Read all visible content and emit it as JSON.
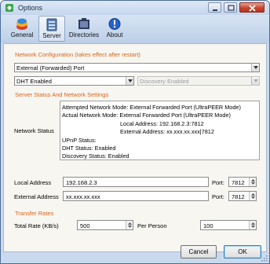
{
  "window": {
    "title": "Options"
  },
  "toolbar": {
    "items": [
      {
        "label": "General",
        "icon": "general-icon"
      },
      {
        "label": "Server",
        "icon": "server-icon",
        "active": true
      },
      {
        "label": "Directories",
        "icon": "directories-icon"
      },
      {
        "label": "About",
        "icon": "about-icon"
      }
    ]
  },
  "network_config": {
    "title": "Network Configuration (takes effect after restart)",
    "mode_select": "External (Forwarded) Port",
    "dht_select": "DHT Enabled",
    "discovery_select": "Discovery Enabled"
  },
  "server_status": {
    "title": "Server Status And Network Settings",
    "label": "Network Status",
    "lines": {
      "attempted": "Attempted Network Mode: External Forwarded Port (UltraPEER Mode)",
      "actual": "Actual Network Mode: External Forwarded Port (UltraPEER Mode)",
      "local": "Local Address: 192.168.2.3:7812",
      "external": "External Address: xx.xxx.xx.xxx|7812",
      "upnp": "UPnP Status:",
      "dht": "DHT Status:  Enabled",
      "discovery": "Discovery Status:  Enabled"
    }
  },
  "addresses": {
    "local_label": "Local Address",
    "local_value": "192.168.2.3",
    "local_port_label": "Port:",
    "local_port": "7812",
    "external_label": "External Address",
    "external_value": "xx.xxx.xx.xxx",
    "external_port_label": "Port:",
    "external_port": "7812"
  },
  "transfer": {
    "title": "Transfer Rates",
    "total_label": "Total Rate (KB/s)",
    "total_value": "500",
    "per_person_label": "Per Person",
    "per_person_value": "100"
  },
  "buttons": {
    "cancel": "Cancel",
    "ok": "OK"
  },
  "colors": {
    "section_title": "#d8641b",
    "window_frame": "#c9daee",
    "close_button": "#c8452f"
  }
}
